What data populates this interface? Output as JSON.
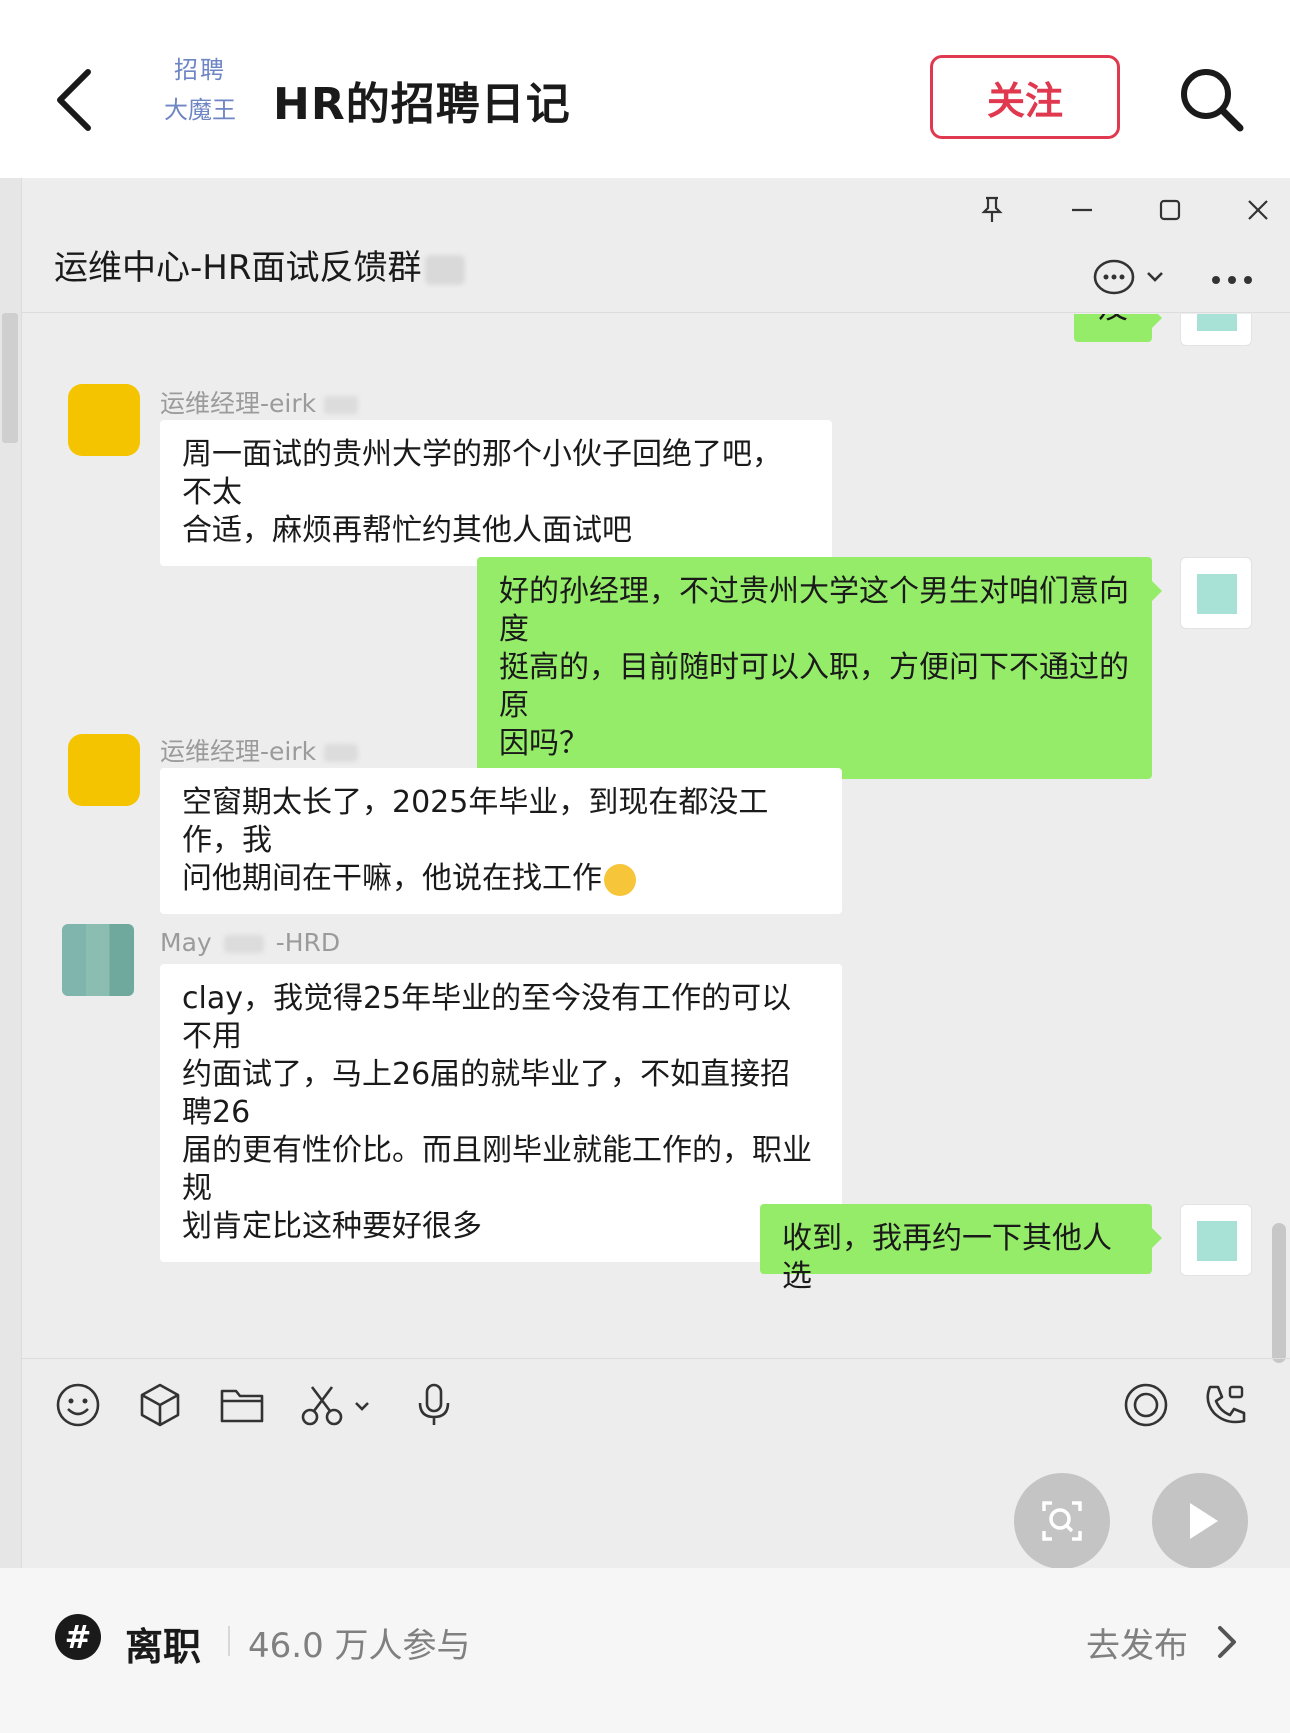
{
  "header": {
    "logo_line1": "招聘",
    "logo_line2": "大魔王",
    "account_name": "HR的招聘日记",
    "follow_label": "关注"
  },
  "window": {
    "group_title": "运维中心-HR面试反馈群"
  },
  "messages": [
    {
      "side": "out",
      "text": "及"
    },
    {
      "side": "in",
      "sender": "运维经理-eirk",
      "text_line1": "周一面试的贵州大学的那个小伙子回绝了吧，不太",
      "text_line2": "合适，麻烦再帮忙约其他人面试吧"
    },
    {
      "side": "out",
      "text_line1": "好的孙经理，不过贵州大学这个男生对咱们意向度",
      "text_line2": "挺高的，目前随时可以入职，方便问下不通过的原",
      "text_line3": "因吗？"
    },
    {
      "side": "in",
      "sender": "运维经理-eirk",
      "text_line1": "空窗期太长了，2025年毕业，到现在都没工作，我",
      "text_line2": "问他期间在干嘛，他说在找工作"
    },
    {
      "side": "in",
      "sender_a": "May",
      "sender_b": "-HRD",
      "text_line1": "clay，我觉得25年毕业的至今没有工作的可以不用",
      "text_line2": "约面试了，马上26届的就毕业了，不如直接招聘26",
      "text_line3": "届的更有性价比。而且刚毕业就能工作的，职业规",
      "text_line4": "划肯定比这种要好很多"
    },
    {
      "side": "out",
      "text": "收到，我再约一下其他人选"
    }
  ],
  "footer": {
    "tag_icon": "#",
    "tag_name": "离职",
    "participants": "46.0 万人参与",
    "publish_label": "去发布"
  },
  "colors": {
    "accent": "#e0384f",
    "bubble_out": "#95ec69",
    "bubble_in": "#ffffff",
    "chat_bg": "#ededed"
  },
  "icons": {
    "toolbar": [
      "emoji-icon",
      "cube-icon",
      "folder-icon",
      "scissors-icon",
      "microphone-icon",
      "record-icon",
      "video-call-icon"
    ]
  }
}
